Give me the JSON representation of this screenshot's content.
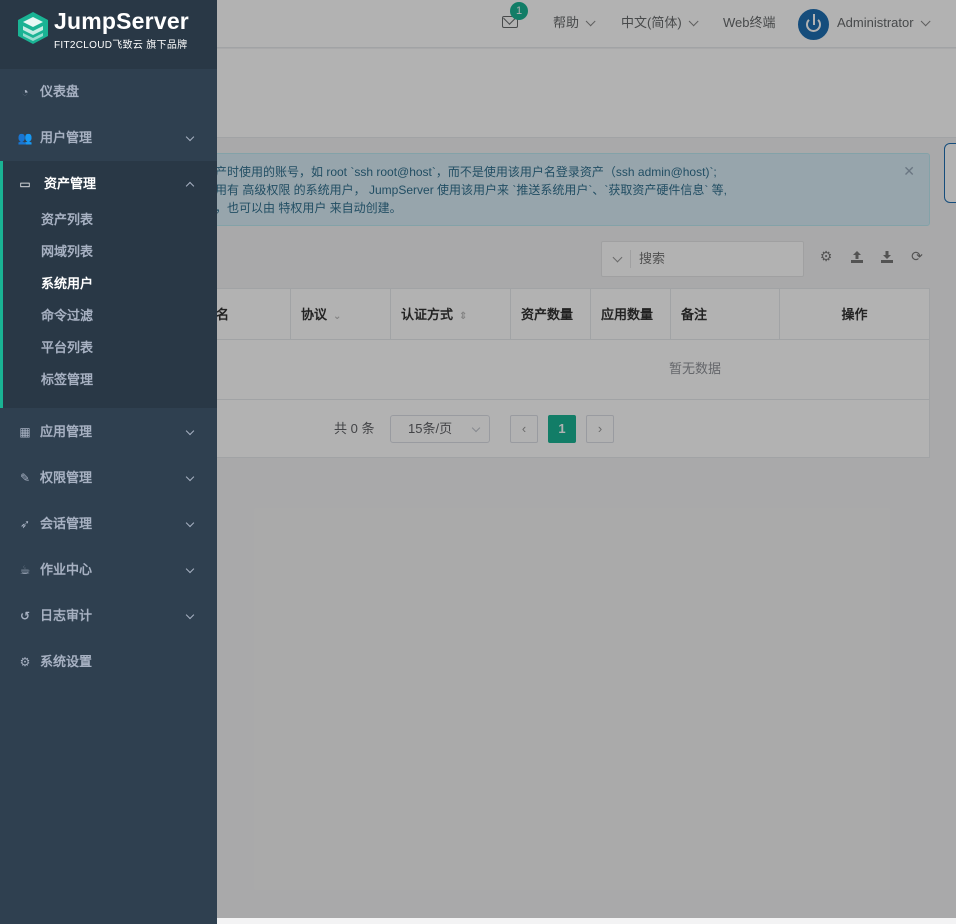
{
  "brand": {
    "title": "JumpServer",
    "subtitle": "FIT2CLOUD飞致云 旗下品牌"
  },
  "topbar": {
    "mail_badge": "1",
    "help": "帮助",
    "language": "中文(简体)",
    "web_terminal": "Web终端",
    "user": "Administrator"
  },
  "sidebar": {
    "items": [
      {
        "label": "仪表盘",
        "icon": "dashboard-icon"
      },
      {
        "label": "用户管理",
        "icon": "users-icon"
      },
      {
        "label": "资产管理",
        "icon": "inbox-icon"
      },
      {
        "label": "应用管理",
        "icon": "grid-icon"
      },
      {
        "label": "权限管理",
        "icon": "edit-icon"
      },
      {
        "label": "会话管理",
        "icon": "rocket-icon"
      },
      {
        "label": "作业中心",
        "icon": "coffee-icon"
      },
      {
        "label": "日志审计",
        "icon": "history-icon"
      },
      {
        "label": "系统设置",
        "icon": "gears-icon"
      }
    ],
    "subitems": [
      {
        "label": "资产列表"
      },
      {
        "label": "网域列表"
      },
      {
        "label": "系统用户"
      },
      {
        "label": "命令过滤"
      },
      {
        "label": "平台列表"
      },
      {
        "label": "标签管理"
      }
    ]
  },
  "alert": {
    "line1": "产时使用的账号，如 root `ssh root@host`，而不是使用该用户名登录资产（ssh admin@host)`;",
    "line2": "用有 高级权限 的系统用户， JumpServer 使用该用户来 `推送系统用户`、`获取资产硬件信息` 等,",
    "line3": "，也可以由 特权用户 来自动创建。"
  },
  "search": {
    "placeholder": "搜索"
  },
  "table": {
    "headers": [
      "名",
      "协议",
      "认证方式",
      "资产数量",
      "应用数量",
      "备注",
      "操作"
    ],
    "empty_text": "暂无数据"
  },
  "pagination": {
    "total": "共 0 条",
    "page_size": "15条/页",
    "prev": "‹",
    "current": "1",
    "next": "›"
  },
  "colors": {
    "accent": "#1ab394",
    "sidebar_bg": "#2f4050",
    "sidebar_active_bg": "#293846",
    "alert_bg": "#d9edf7"
  }
}
